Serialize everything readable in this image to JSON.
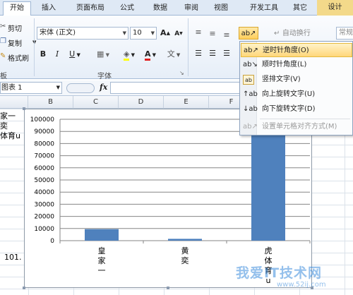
{
  "tabs": [
    "开始",
    "插入",
    "页面布局",
    "公式",
    "数据",
    "审阅",
    "视图",
    "开发工具",
    "其它",
    "设计"
  ],
  "clipboard": {
    "cut": "剪切",
    "copy": "复制",
    "format_painter": "格式刷",
    "group_label": "板"
  },
  "font": {
    "name": "宋体 (正文)",
    "size": "10",
    "bold": "B",
    "italic": "I",
    "underline": "U",
    "grow": "A",
    "shrink": "A",
    "color_glyph": "A",
    "group_label": "字体"
  },
  "alignment": {
    "wrap_text": "自动换行",
    "format_label": "常规"
  },
  "formula_bar": {
    "name_box": "图表 1",
    "fx": "fx"
  },
  "columns": [
    "B",
    "C",
    "D",
    "E",
    "F"
  ],
  "cells": {
    "a1": "家一",
    "a2": "奕",
    "a3": "体育u",
    "a13": "101."
  },
  "orientation_menu": {
    "items": [
      {
        "label": "逆时针角度(O)",
        "highlighted": true,
        "disabled": false,
        "icon": "rotate-ccw-icon"
      },
      {
        "label": "顺时针角度(L)",
        "highlighted": false,
        "disabled": false,
        "icon": "rotate-cw-icon"
      },
      {
        "label": "竖排文字(V)",
        "highlighted": false,
        "disabled": false,
        "icon": "vertical-text-icon"
      },
      {
        "label": "向上旋转文字(U)",
        "highlighted": false,
        "disabled": false,
        "icon": "rotate-up-icon"
      },
      {
        "label": "向下旋转文字(D)",
        "highlighted": false,
        "disabled": false,
        "icon": "rotate-down-icon"
      },
      {
        "label": "设置单元格对齐方式(M)",
        "highlighted": false,
        "disabled": true,
        "icon": "format-alignment-icon"
      }
    ]
  },
  "chart_data": {
    "type": "bar",
    "categories": [
      "皇家一",
      "黄奕",
      "虎体育u"
    ],
    "values": [
      9500,
      1500,
      100000
    ],
    "title": "",
    "xlabel": "",
    "ylabel": "",
    "ylim": [
      0,
      100000
    ],
    "yticks": [
      "0",
      "10000",
      "20000",
      "30000",
      "40000",
      "50000",
      "60000",
      "70000",
      "80000",
      "90000",
      "100000"
    ],
    "grid": true,
    "legend": "none",
    "bar_color": "#4f81bd"
  },
  "watermark": {
    "main": "我爱IT技术网",
    "sub": "www.52ij.com"
  },
  "colors": {
    "accent": "#4f81bd",
    "design_tab": "#f3d98a",
    "highlight": "#ffd77a"
  }
}
